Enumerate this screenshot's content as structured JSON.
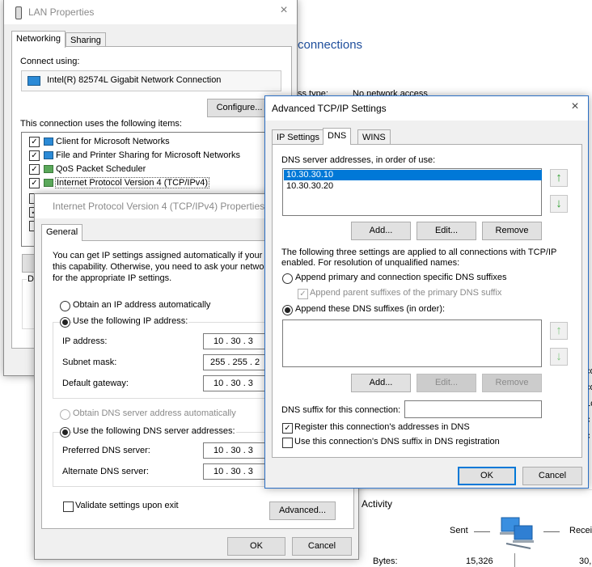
{
  "background": {
    "heading": "connections",
    "access_type_label": "ss type:",
    "access_type_value": "No network access",
    "right_texts": [
      "co",
      "co",
      "1c",
      "c",
      "c"
    ],
    "activity_label": "Activity",
    "sent_label": "Sent",
    "received_label": "Recei",
    "bytes_label": "Bytes:",
    "bytes_sent": "15,326",
    "bytes_received": "30,"
  },
  "lan": {
    "title": "LAN Properties",
    "tabs": [
      "Networking",
      "Sharing"
    ],
    "connect_using_label": "Connect using:",
    "adapter_name": "Intel(R) 82574L Gigabit Network Connection",
    "configure_label": "Configure...",
    "items_label": "This connection uses the following items:",
    "items": [
      {
        "label": "Client for Microsoft Networks",
        "checked": true
      },
      {
        "label": "File and Printer Sharing for Microsoft Networks",
        "checked": true
      },
      {
        "label": "QoS Packet Scheduler",
        "checked": true
      },
      {
        "label": "Internet Protocol Version 4 (TCP/IPv4)",
        "checked": true
      }
    ],
    "desc_fragment": "D"
  },
  "ipv4": {
    "title": "Internet Protocol Version 4 (TCP/IPv4) Properties",
    "tab_general": "General",
    "intro_line1": "You can get IP settings assigned automatically if your n",
    "intro_line2": "this capability. Otherwise, you need to ask your netwo",
    "intro_line3": "for the appropriate IP settings.",
    "obtain_ip_auto": "Obtain an IP address automatically",
    "use_following_ip": "Use the following IP address:",
    "ip_address_label": "IP address:",
    "ip_address_value": "10  .  30  .  3",
    "subnet_label": "Subnet mask:",
    "subnet_value": "255 . 255 . 2",
    "gateway_label": "Default gateway:",
    "gateway_value": "10  .  30  .  3",
    "obtain_dns_auto": "Obtain DNS server address automatically",
    "use_following_dns": "Use the following DNS server addresses:",
    "preferred_dns_label": "Preferred DNS server:",
    "preferred_dns_value": "10  .  30  .  3",
    "alternate_dns_label": "Alternate DNS server:",
    "alternate_dns_value": "10  .  30  .  3",
    "validate_label": "Validate settings upon exit",
    "advanced_label": "Advanced...",
    "ok_label": "OK",
    "cancel_label": "Cancel"
  },
  "advanced": {
    "title": "Advanced TCP/IP Settings",
    "tabs": [
      "IP Settings",
      "DNS",
      "WINS"
    ],
    "dns_list_label": "DNS server addresses, in order of use:",
    "dns_servers": [
      "10.30.30.10",
      "10.30.30.20"
    ],
    "add_label": "Add...",
    "edit_label": "Edit...",
    "remove_label": "Remove",
    "info_line1": "The following three settings are applied to all connections with TCP/IP",
    "info_line2": "enabled. For resolution of unqualified names:",
    "append_primary": "Append primary and connection specific DNS suffixes",
    "append_parent": "Append parent suffixes of the primary DNS suffix",
    "append_these": "Append these DNS suffixes (in order):",
    "suffix_label": "DNS suffix for this connection:",
    "suffix_value": "",
    "register_label": "Register this connection's addresses in DNS",
    "use_suffix_label": "Use this connection's DNS suffix in DNS registration",
    "ok_label": "OK",
    "cancel_label": "Cancel"
  },
  "colors": {
    "accent": "#0078d7",
    "heading_blue": "#1e4e9c",
    "arrow_green": "#2e9e2e"
  }
}
